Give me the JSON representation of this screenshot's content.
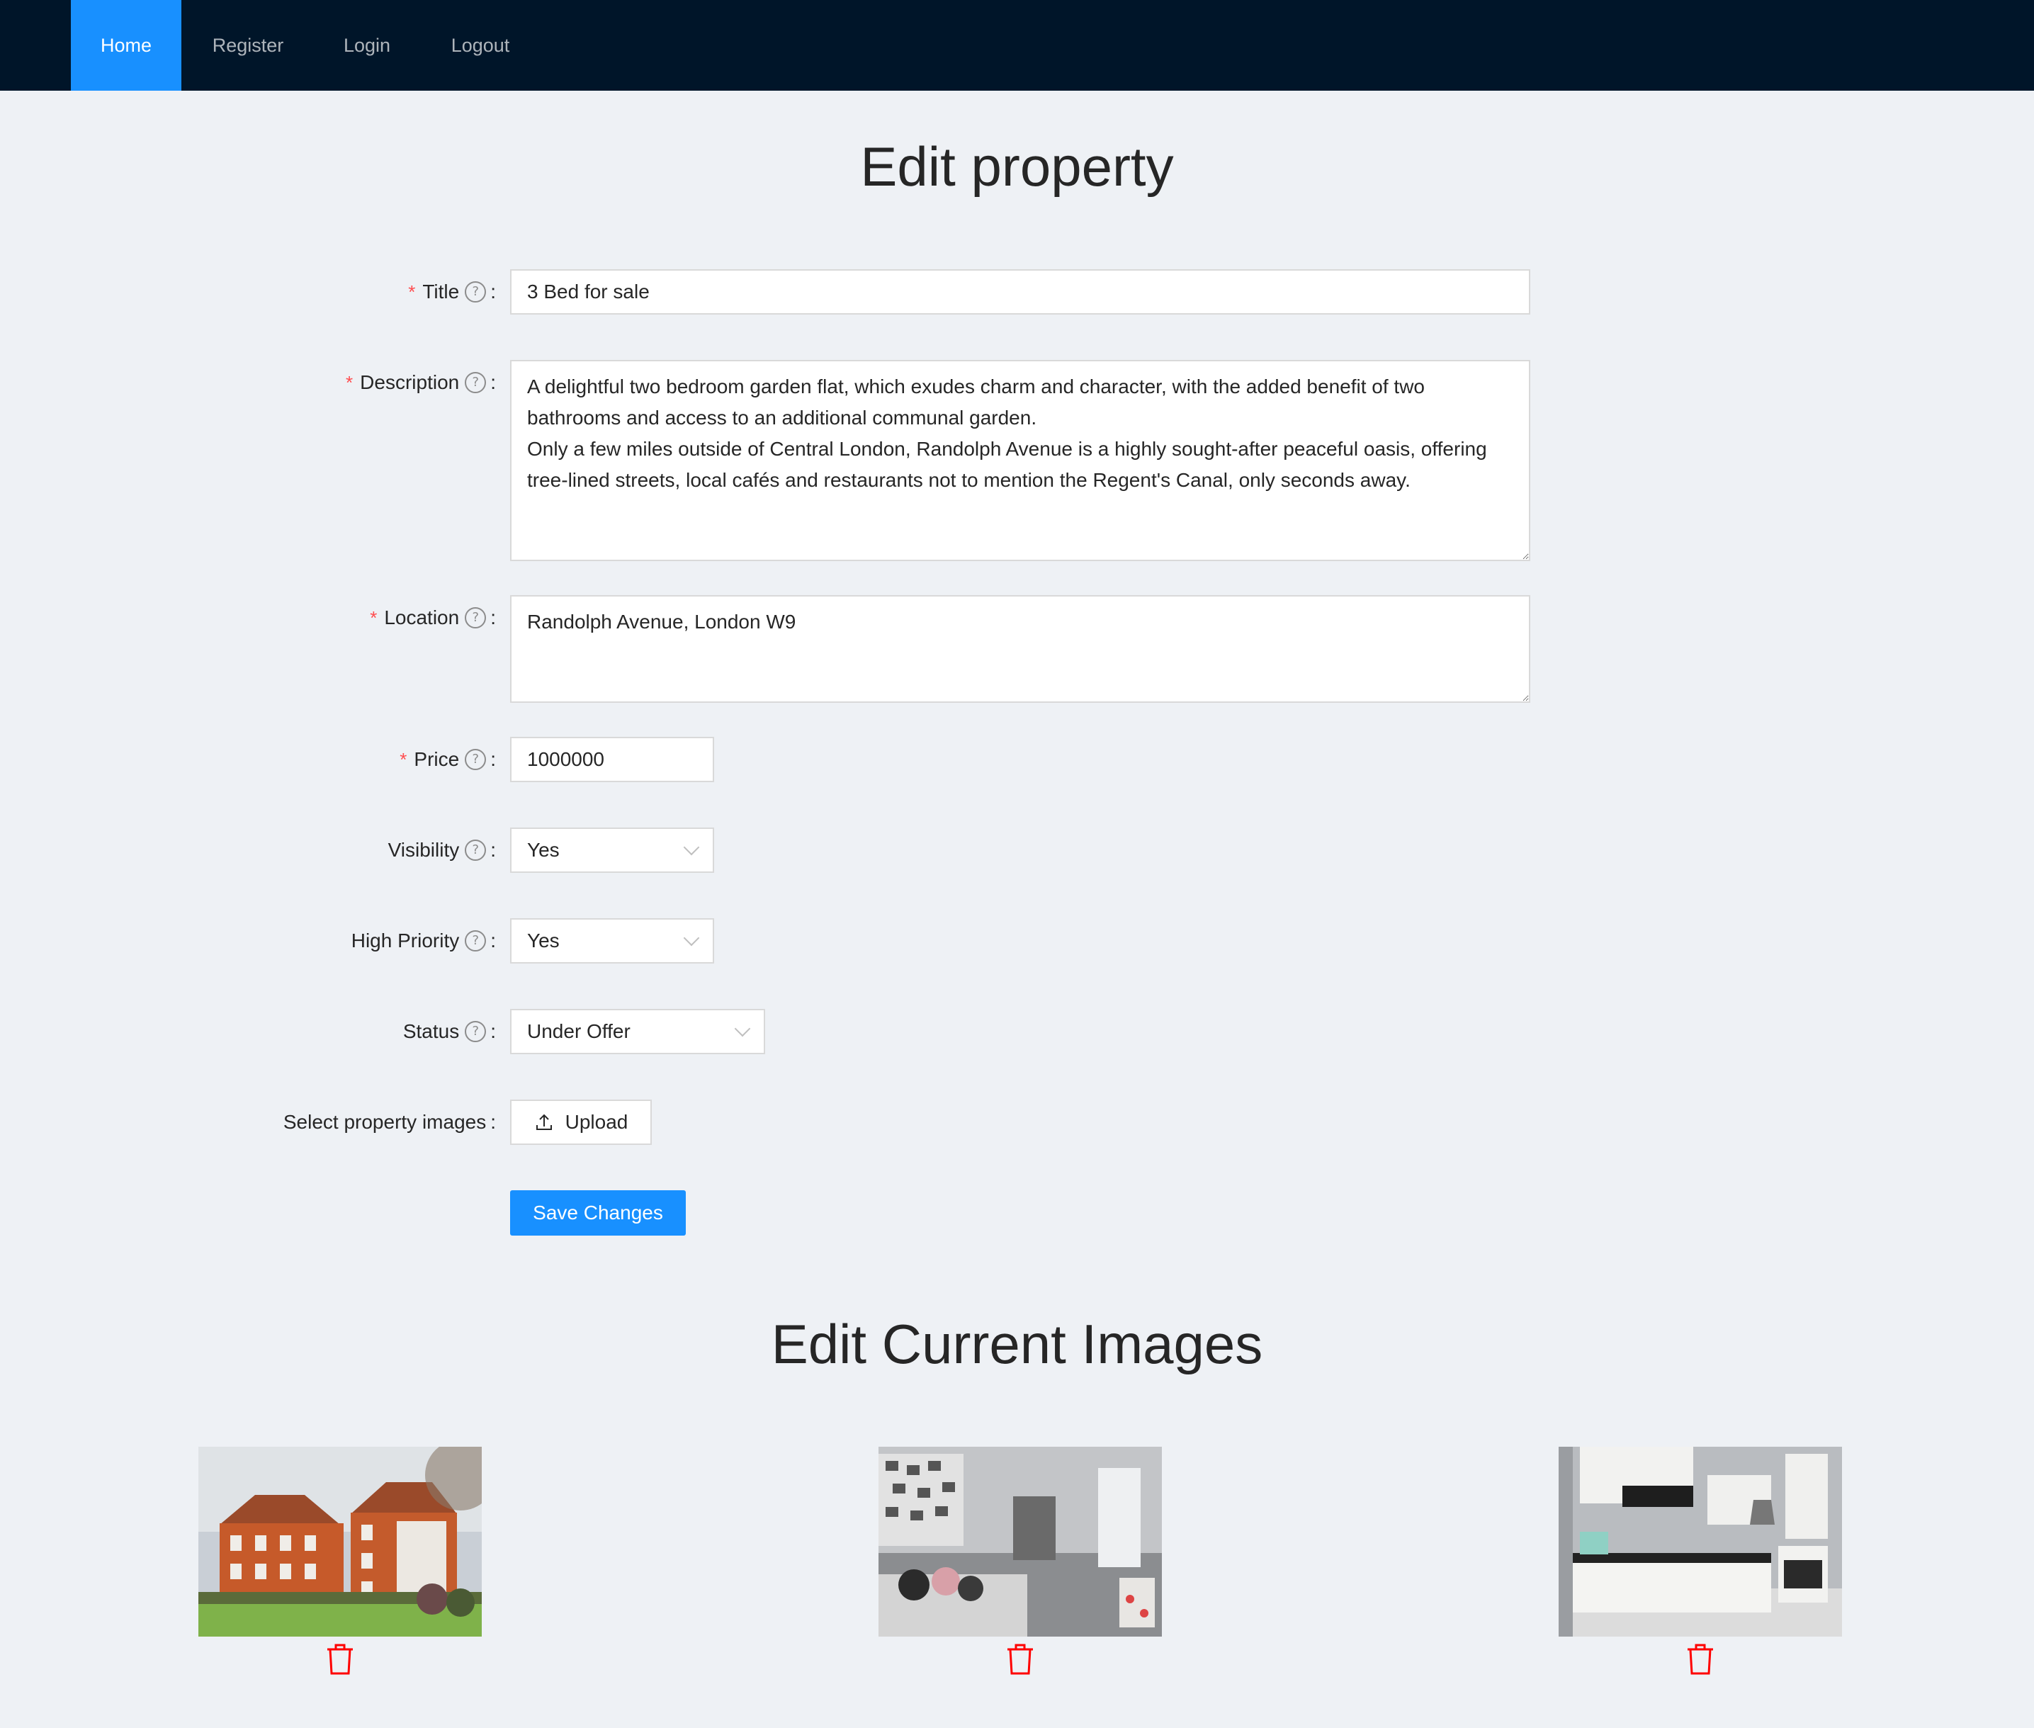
{
  "nav": {
    "items": [
      {
        "label": "Home",
        "active": true
      },
      {
        "label": "Register",
        "active": false
      },
      {
        "label": "Login",
        "active": false
      },
      {
        "label": "Logout",
        "active": false
      }
    ]
  },
  "page_title": "Edit property",
  "form": {
    "title": {
      "label": "Title",
      "required": true,
      "value": "3 Bed for sale"
    },
    "description": {
      "label": "Description",
      "required": true,
      "value": "A delightful two bedroom garden flat, which exudes charm and character, with the added benefit of two bathrooms and access to an additional communal garden.\nOnly a few miles outside of Central London, Randolph Avenue is a highly sought-after peaceful oasis, offering tree-lined streets, local cafés and restaurants not to mention the Regent's Canal, only seconds away."
    },
    "location": {
      "label": "Location",
      "required": true,
      "value": "Randolph Avenue, London W9"
    },
    "price": {
      "label": "Price",
      "required": true,
      "value": "1000000"
    },
    "visibility": {
      "label": "Visibility",
      "value": "Yes"
    },
    "high_priority": {
      "label": "High Priority",
      "value": "Yes"
    },
    "status": {
      "label": "Status",
      "value": "Under Offer"
    },
    "images": {
      "label": "Select property images",
      "upload_label": "Upload"
    },
    "save_label": "Save Changes",
    "help_glyph": "?",
    "required_glyph": "*",
    "colon": ":"
  },
  "images_section": {
    "title": "Edit Current Images",
    "images": [
      {
        "name": "property-exterior-image",
        "delete_icon": "trash-icon"
      },
      {
        "name": "living-room-image",
        "delete_icon": "trash-icon"
      },
      {
        "name": "kitchen-image",
        "delete_icon": "trash-icon"
      }
    ]
  },
  "colors": {
    "nav_bg": "#001529",
    "accent": "#1890ff",
    "danger": "#ff0000",
    "page_bg": "#eef1f5"
  }
}
